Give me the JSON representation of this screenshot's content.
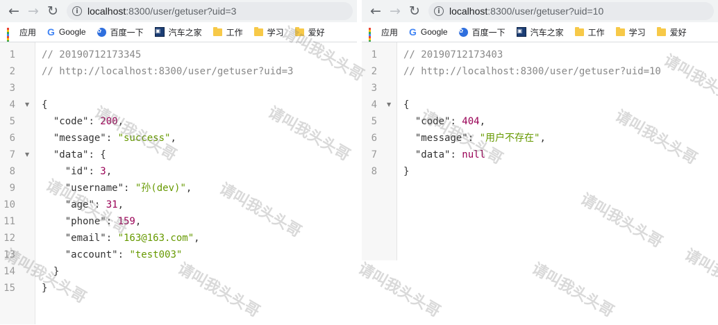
{
  "windows": [
    {
      "nav": {
        "back": "←",
        "forward": "→",
        "reload": "↻"
      },
      "url": {
        "host": "localhost",
        "path": ":8300/user/getuser?uid=3"
      },
      "bookmarks": [
        {
          "label": "应用",
          "icon": "apps-icon"
        },
        {
          "label": "Google",
          "icon": "google-icon"
        },
        {
          "label": "百度一下",
          "icon": "baidu-paw-icon"
        },
        {
          "label": "汽车之家",
          "icon": "autohome-icon"
        },
        {
          "label": "工作",
          "icon": "folder-icon"
        },
        {
          "label": "学习",
          "icon": "folder-icon"
        },
        {
          "label": "爱好",
          "icon": "folder-icon"
        }
      ],
      "lines": [
        {
          "n": "1",
          "fold": "",
          "tokens": [
            [
              "c-comment",
              "// 20190712173345"
            ]
          ]
        },
        {
          "n": "2",
          "fold": "",
          "tokens": [
            [
              "c-comment",
              "// http://localhost:8300/user/getuser?uid=3"
            ]
          ]
        },
        {
          "n": "3",
          "fold": "",
          "tokens": []
        },
        {
          "n": "4",
          "fold": "▼",
          "tokens": [
            [
              "c-punct",
              "{"
            ]
          ]
        },
        {
          "n": "5",
          "fold": "",
          "tokens": [
            [
              "c-key",
              "  \"code\""
            ],
            [
              "c-punct",
              ": "
            ],
            [
              "c-num",
              "200"
            ],
            [
              "c-punct",
              ","
            ]
          ]
        },
        {
          "n": "6",
          "fold": "",
          "tokens": [
            [
              "c-key",
              "  \"message\""
            ],
            [
              "c-punct",
              ": "
            ],
            [
              "c-str",
              "\"success\""
            ],
            [
              "c-punct",
              ","
            ]
          ]
        },
        {
          "n": "7",
          "fold": "▼",
          "tokens": [
            [
              "c-key",
              "  \"data\""
            ],
            [
              "c-punct",
              ": {"
            ]
          ]
        },
        {
          "n": "8",
          "fold": "",
          "tokens": [
            [
              "c-key",
              "    \"id\""
            ],
            [
              "c-punct",
              ": "
            ],
            [
              "c-num",
              "3"
            ],
            [
              "c-punct",
              ","
            ]
          ]
        },
        {
          "n": "9",
          "fold": "",
          "tokens": [
            [
              "c-key",
              "    \"username\""
            ],
            [
              "c-punct",
              ": "
            ],
            [
              "c-str",
              "\"孙(dev)\""
            ],
            [
              "c-punct",
              ","
            ]
          ]
        },
        {
          "n": "10",
          "fold": "",
          "tokens": [
            [
              "c-key",
              "    \"age\""
            ],
            [
              "c-punct",
              ": "
            ],
            [
              "c-num",
              "31"
            ],
            [
              "c-punct",
              ","
            ]
          ]
        },
        {
          "n": "11",
          "fold": "",
          "tokens": [
            [
              "c-key",
              "    \"phone\""
            ],
            [
              "c-punct",
              ": "
            ],
            [
              "c-num",
              "159"
            ],
            [
              "c-punct",
              ","
            ]
          ]
        },
        {
          "n": "12",
          "fold": "",
          "tokens": [
            [
              "c-key",
              "    \"email\""
            ],
            [
              "c-punct",
              ": "
            ],
            [
              "c-str",
              "\"163@163.com\""
            ],
            [
              "c-punct",
              ","
            ]
          ]
        },
        {
          "n": "13",
          "fold": "",
          "tokens": [
            [
              "c-key",
              "    \"account\""
            ],
            [
              "c-punct",
              ": "
            ],
            [
              "c-str",
              "\"test003\""
            ]
          ]
        },
        {
          "n": "14",
          "fold": "",
          "tokens": [
            [
              "c-punct",
              "  }"
            ]
          ]
        },
        {
          "n": "15",
          "fold": "",
          "tokens": [
            [
              "c-punct",
              "}"
            ]
          ]
        }
      ]
    },
    {
      "nav": {
        "back": "←",
        "forward": "→",
        "reload": "↻"
      },
      "url": {
        "host": "localhost",
        "path": ":8300/user/getuser?uid=10"
      },
      "bookmarks": [
        {
          "label": "应用",
          "icon": "apps-icon"
        },
        {
          "label": "Google",
          "icon": "google-icon"
        },
        {
          "label": "百度一下",
          "icon": "baidu-paw-icon"
        },
        {
          "label": "汽车之家",
          "icon": "autohome-icon"
        },
        {
          "label": "工作",
          "icon": "folder-icon"
        },
        {
          "label": "学习",
          "icon": "folder-icon"
        },
        {
          "label": "爱好",
          "icon": "folder-icon"
        }
      ],
      "lines": [
        {
          "n": "1",
          "fold": "",
          "tokens": [
            [
              "c-comment",
              "// 20190712173403"
            ]
          ]
        },
        {
          "n": "2",
          "fold": "",
          "tokens": [
            [
              "c-comment",
              "// http://localhost:8300/user/getuser?uid=10"
            ]
          ]
        },
        {
          "n": "3",
          "fold": "",
          "tokens": []
        },
        {
          "n": "4",
          "fold": "▼",
          "tokens": [
            [
              "c-punct",
              "{"
            ]
          ]
        },
        {
          "n": "5",
          "fold": "",
          "tokens": [
            [
              "c-key",
              "  \"code\""
            ],
            [
              "c-punct",
              ": "
            ],
            [
              "c-num",
              "404"
            ],
            [
              "c-punct",
              ","
            ]
          ]
        },
        {
          "n": "6",
          "fold": "",
          "tokens": [
            [
              "c-key",
              "  \"message\""
            ],
            [
              "c-punct",
              ": "
            ],
            [
              "c-str",
              "\"用户不存在\""
            ],
            [
              "c-punct",
              ","
            ]
          ]
        },
        {
          "n": "7",
          "fold": "",
          "tokens": [
            [
              "c-key",
              "  \"data\""
            ],
            [
              "c-punct",
              ": "
            ],
            [
              "c-null",
              "null"
            ]
          ]
        },
        {
          "n": "8",
          "fold": "",
          "tokens": [
            [
              "c-punct",
              "}"
            ]
          ]
        }
      ]
    }
  ],
  "watermark": "请叫我头头哥",
  "colors": {
    "string": "#669900",
    "number": "#990055",
    "comment": "#888888",
    "gutter": "#f7f7f7"
  }
}
